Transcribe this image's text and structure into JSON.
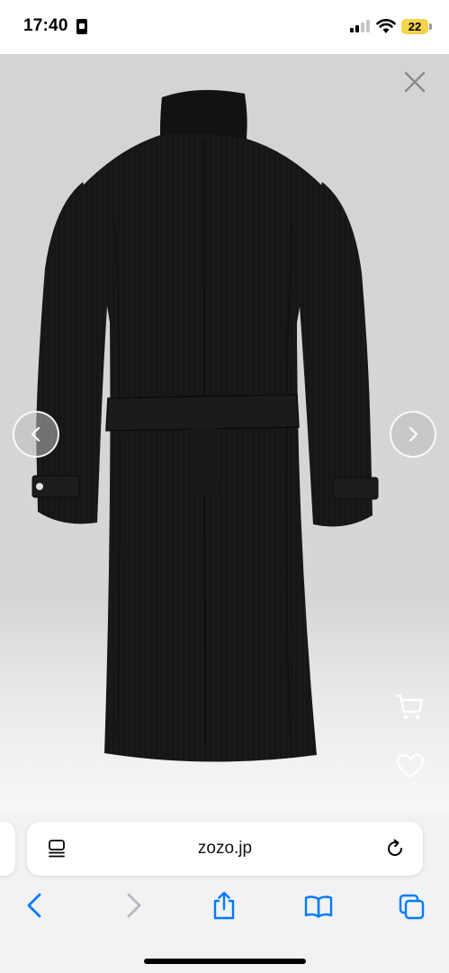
{
  "status_bar": {
    "time": "17:40",
    "battery": "22",
    "battery_color": "#f5d34a"
  },
  "viewer": {
    "icons": {
      "close": "close-icon",
      "previous": "chevron-left-icon",
      "next": "chevron-right-icon",
      "cart": "cart-icon",
      "favorite": "heart-icon"
    },
    "background": "#d4d4d4",
    "product_color": "#161616"
  },
  "browser": {
    "url": "zozo.jp",
    "toolbar": [
      "back-icon",
      "forward-icon",
      "share-icon",
      "bookmarks-icon",
      "tabs-icon"
    ],
    "accent": "#007aff"
  }
}
